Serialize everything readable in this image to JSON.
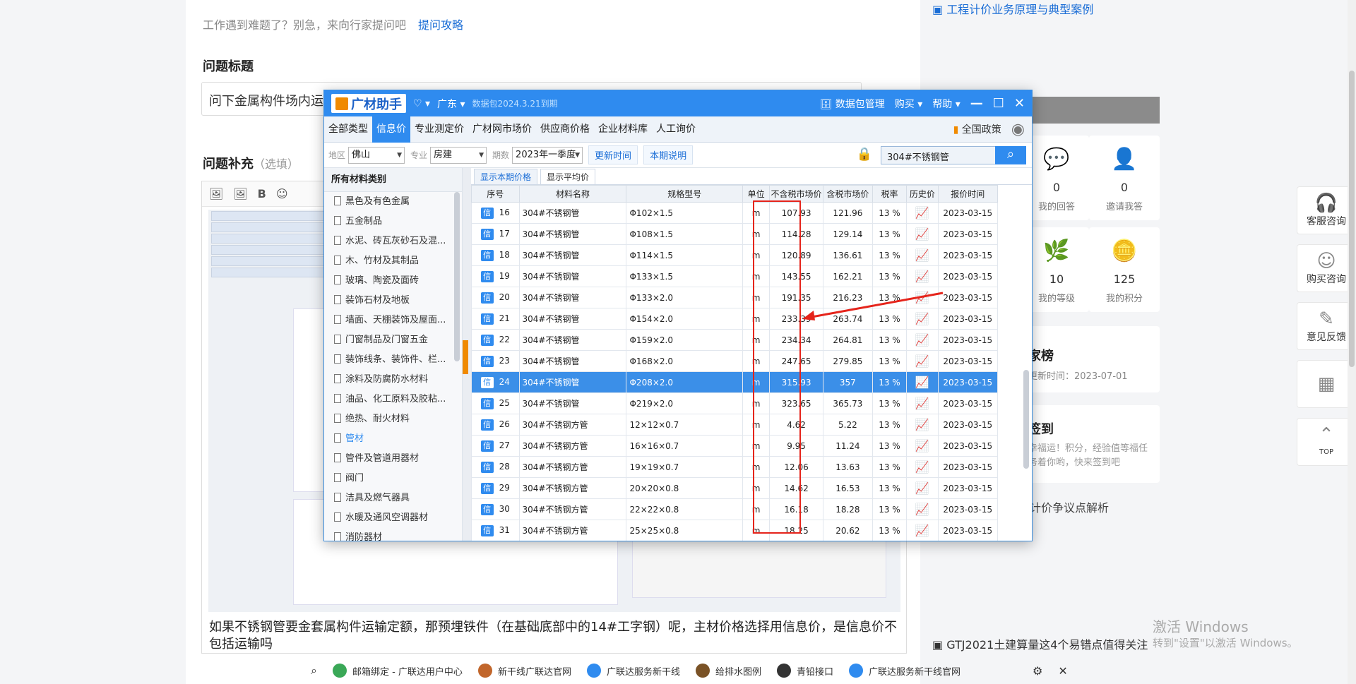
{
  "page": {
    "hint_text": "工作遇到难题了？别急，来向行家提问吧",
    "hint_link": "提问攻略",
    "title_section": "问题标题",
    "title_value": "问下金属构件场内运",
    "detail_section": "问题补充",
    "detail_optional": "（选填）",
    "editor_text": "如果不锈钢管要金套属构件运输定额，那预埋铁件（在基础底部中的14#工字钢）呢，主材价格选择用信息价，是信息价不包括运输吗",
    "toolbar": {
      "bold": "B"
    }
  },
  "sidebar": {
    "banner_link": "工程计价业务原理与典型案例",
    "stats": [
      {
        "value": "0",
        "label": "我的回答"
      },
      {
        "value": "0",
        "label": "邀请我答"
      },
      {
        "value": "10",
        "label": "我的等级"
      },
      {
        "value": "125",
        "label": "我的积分"
      }
    ],
    "rank_title": "家榜",
    "rank_update": "更新时间：2023-07-01",
    "signin_title": "签到",
    "signin_desc": "幸福运！积分，经验值等福任务着你哟，快来签到吧",
    "article_link": "计价争议点解析",
    "bottom_link": "GTJ2021土建算量这4个易错点值得关注"
  },
  "side_buttons": [
    "客服咨询",
    "购买咨询",
    "意见反馈",
    "",
    "TOP"
  ],
  "watermark": {
    "line1": "激活 Windows",
    "line2": "转到\"设置\"以激活 Windows。"
  },
  "taskbar": [
    "邮箱绑定 - 广联达用户中心",
    "新干线广联达官网",
    "广联达服务新干线",
    "给排水图例",
    "青铅接口",
    "广联达服务新干线官网"
  ],
  "app": {
    "logo": "广材助手",
    "region": "广东",
    "data_pack": "数据包2024.3.21到期",
    "data_mgr": "数据包管理",
    "buy": "购买",
    "help": "帮助",
    "tabs": [
      "全部类型",
      "信息价",
      "专业测定价",
      "广材网市场价",
      "供应商价格",
      "企业材料库",
      "人工询价"
    ],
    "active_tab": 1,
    "policy": "全国政策",
    "filter": {
      "area_label": "地区",
      "area": "佛山",
      "major_label": "专业",
      "major": "房建",
      "period_label": "期数",
      "period": "2023年一季度",
      "update_btn": "更新时间",
      "explain_btn": "本期说明",
      "search": "304#不锈钢管"
    },
    "category_head": "所有材料类别",
    "categories": [
      "黑色及有色金属",
      "五金制品",
      "水泥、砖瓦灰砂石及混...",
      "木、竹材及其制品",
      "玻璃、陶瓷及面砖",
      "装饰石材及地板",
      "墙面、天棚装饰及屋面...",
      "门窗制品及门窗五金",
      "装饰线条、装饰件、栏...",
      "涂料及防腐防水材料",
      "油品、化工原料及胶粘...",
      "绝热、耐火材料",
      "管材",
      "管件及管道用器材",
      "阀门",
      "洁具及燃气器具",
      "水暖及通风空调器材",
      "消防器材"
    ],
    "active_category": 12,
    "subtabs": [
      "显示本期价格",
      "显示平均价"
    ],
    "columns": [
      "序号",
      "材料名称",
      "规格型号",
      "单位",
      "不含税市场价",
      "含税市场价",
      "税率",
      "历史价",
      "报价时间"
    ],
    "tag": "信",
    "rows": [
      {
        "no": "16",
        "name": "304#不锈钢管",
        "spec": "Φ102×1.5",
        "unit": "m",
        "price": "107.93",
        "tax_price": "121.96",
        "rate": "13 %",
        "date": "2023-03-15"
      },
      {
        "no": "17",
        "name": "304#不锈钢管",
        "spec": "Φ108×1.5",
        "unit": "m",
        "price": "114.28",
        "tax_price": "129.14",
        "rate": "13 %",
        "date": "2023-03-15"
      },
      {
        "no": "18",
        "name": "304#不锈钢管",
        "spec": "Φ114×1.5",
        "unit": "m",
        "price": "120.89",
        "tax_price": "136.61",
        "rate": "13 %",
        "date": "2023-03-15"
      },
      {
        "no": "19",
        "name": "304#不锈钢管",
        "spec": "Φ133×1.5",
        "unit": "m",
        "price": "143.55",
        "tax_price": "162.21",
        "rate": "13 %",
        "date": "2023-03-15"
      },
      {
        "no": "20",
        "name": "304#不锈钢管",
        "spec": "Φ133×2.0",
        "unit": "m",
        "price": "191.35",
        "tax_price": "216.23",
        "rate": "13 %",
        "date": "2023-03-15"
      },
      {
        "no": "21",
        "name": "304#不锈钢管",
        "spec": "Φ154×2.0",
        "unit": "m",
        "price": "233.39",
        "tax_price": "263.74",
        "rate": "13 %",
        "date": "2023-03-15"
      },
      {
        "no": "22",
        "name": "304#不锈钢管",
        "spec": "Φ159×2.0",
        "unit": "m",
        "price": "234.34",
        "tax_price": "264.81",
        "rate": "13 %",
        "date": "2023-03-15"
      },
      {
        "no": "23",
        "name": "304#不锈钢管",
        "spec": "Φ168×2.0",
        "unit": "m",
        "price": "247.65",
        "tax_price": "279.85",
        "rate": "13 %",
        "date": "2023-03-15"
      },
      {
        "no": "24",
        "name": "304#不锈钢管",
        "spec": "Φ208×2.0",
        "unit": "m",
        "price": "315.93",
        "tax_price": "357",
        "rate": "13 %",
        "date": "2023-03-15"
      },
      {
        "no": "25",
        "name": "304#不锈钢管",
        "spec": "Φ219×2.0",
        "unit": "m",
        "price": "323.65",
        "tax_price": "365.73",
        "rate": "13 %",
        "date": "2023-03-15"
      },
      {
        "no": "26",
        "name": "304#不锈钢方管",
        "spec": "12×12×0.7",
        "unit": "m",
        "price": "4.62",
        "tax_price": "5.22",
        "rate": "13 %",
        "date": "2023-03-15"
      },
      {
        "no": "27",
        "name": "304#不锈钢方管",
        "spec": "16×16×0.7",
        "unit": "m",
        "price": "9.95",
        "tax_price": "11.24",
        "rate": "13 %",
        "date": "2023-03-15"
      },
      {
        "no": "28",
        "name": "304#不锈钢方管",
        "spec": "19×19×0.7",
        "unit": "m",
        "price": "12.06",
        "tax_price": "13.63",
        "rate": "13 %",
        "date": "2023-03-15"
      },
      {
        "no": "29",
        "name": "304#不锈钢方管",
        "spec": "20×20×0.8",
        "unit": "m",
        "price": "14.62",
        "tax_price": "16.53",
        "rate": "13 %",
        "date": "2023-03-15"
      },
      {
        "no": "30",
        "name": "304#不锈钢方管",
        "spec": "22×22×0.8",
        "unit": "m",
        "price": "16.18",
        "tax_price": "18.28",
        "rate": "13 %",
        "date": "2023-03-15"
      },
      {
        "no": "31",
        "name": "304#不锈钢方管",
        "spec": "25×25×0.8",
        "unit": "m",
        "price": "18.25",
        "tax_price": "20.62",
        "rate": "13 %",
        "date": "2023-03-15"
      }
    ],
    "selected_row": 8
  }
}
